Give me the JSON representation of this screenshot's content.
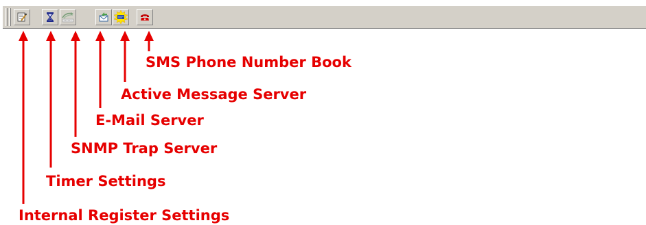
{
  "toolbar": {
    "buttons": [
      {
        "icon": "notepad-icon"
      },
      {
        "icon": "hourglass-icon"
      },
      {
        "icon": "snmp-trap-icon"
      },
      {
        "icon": "mail-icon"
      },
      {
        "icon": "active-message-icon"
      },
      {
        "icon": "phone-icon"
      }
    ]
  },
  "callouts": {
    "internal_register": "Internal Register Settings",
    "timer": "Timer Settings",
    "snmp_trap": "SNMP Trap Server",
    "email": "E-Mail Server",
    "active_message": "Active Message Server",
    "sms_phonebook": "SMS Phone Number Book"
  },
  "colors": {
    "annotation": "#e60000",
    "toolbar_face": "#d4d0c8"
  }
}
